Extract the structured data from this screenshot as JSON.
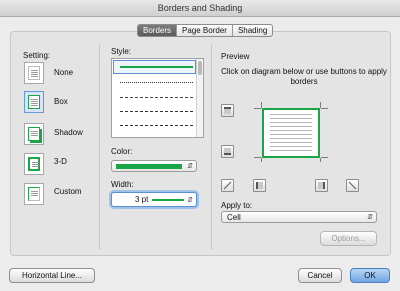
{
  "window": {
    "title": "Borders and Shading"
  },
  "tabs": [
    {
      "label": "Borders",
      "active": true
    },
    {
      "label": "Page Border",
      "active": false
    },
    {
      "label": "Shading",
      "active": false
    }
  ],
  "setting": {
    "label": "Setting:",
    "options": [
      {
        "label": "None",
        "selected": false
      },
      {
        "label": "Box",
        "selected": true
      },
      {
        "label": "Shadow",
        "selected": false
      },
      {
        "label": "3-D",
        "selected": false
      },
      {
        "label": "Custom",
        "selected": false
      }
    ]
  },
  "style": {
    "label": "Style:",
    "lines": [
      "solid",
      "dotted",
      "dashed-fine",
      "dashed",
      "dash-dot"
    ]
  },
  "color": {
    "label": "Color:",
    "value_color": "#1aa546"
  },
  "width": {
    "label": "Width:",
    "value": "3 pt"
  },
  "preview": {
    "label": "Preview",
    "instructions": "Click on diagram below or use buttons to apply borders"
  },
  "apply_to": {
    "label": "Apply to:",
    "value": "Cell"
  },
  "buttons": {
    "options": "Options...",
    "horizontal_line": "Horizontal Line...",
    "cancel": "Cancel",
    "ok": "OK"
  },
  "colors": {
    "accent": "#1aa546",
    "primary_button": "#6fa5e2"
  }
}
